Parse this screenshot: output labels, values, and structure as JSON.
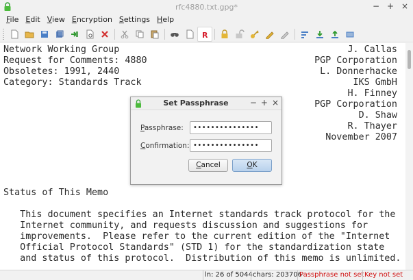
{
  "window": {
    "title": "rfc4880.txt.gpg*",
    "controls": [
      "−",
      "+",
      "×"
    ]
  },
  "menubar": [
    {
      "label": "File",
      "accel": "F",
      "rest": "ile"
    },
    {
      "label": "Edit",
      "accel": "E",
      "rest": "dit"
    },
    {
      "label": "View",
      "accel": "V",
      "rest": "iew"
    },
    {
      "label": "Encryption",
      "accel": "E",
      "rest": "ncryption"
    },
    {
      "label": "Settings",
      "accel": "S",
      "rest": "ettings"
    },
    {
      "label": "Help",
      "accel": "H",
      "rest": "elp"
    }
  ],
  "toolbar_icons": [
    "new-file-icon",
    "open-folder-icon",
    "save-icon",
    "save-as-icon",
    "reload-icon",
    "print-preview-icon",
    "close-icon",
    "cut-icon",
    "copy-icon",
    "paste-icon",
    "find-icon",
    "read-only-icon",
    "lock-icon",
    "unlock-icon",
    "key-icon",
    "key-edit-icon",
    "clear-icon",
    "sort-icon",
    "import-icon",
    "export-icon"
  ],
  "editor": {
    "header_left": [
      "Network Working Group",
      "Request for Comments: 4880",
      "Obsoletes: 1991, 2440",
      "Category: Standards Track"
    ],
    "header_right": [
      "J. Callas",
      "PGP Corporation",
      "L. Donnerhacke",
      "IKS GmbH",
      "H. Finney",
      "PGP Corporation",
      "D. Shaw",
      "R. Thayer",
      "November 2007"
    ],
    "section_title": "Status of This Memo",
    "body": [
      "   This document specifies an Internet standards track protocol for the",
      "   Internet community, and requests discussion and suggestions for",
      "   improvements.  Please refer to the current edition of the \"Internet",
      "   Official Protocol Standards\" (STD 1) for the standardization state",
      "   and status of this protocol.  Distribution of this memo is unlimited."
    ]
  },
  "statusbar": {
    "line": "ln: 26 of 5044",
    "chars": "chars: 203706",
    "passphrase": "Passphrase not set",
    "key": "Key not set",
    "warn_color": "#d01010"
  },
  "dialog": {
    "title": "Set Passphrase",
    "controls": [
      "−",
      "+",
      "×"
    ],
    "passphrase_label": "Passphrase:",
    "passphrase_value": "•••••••••••••••",
    "confirmation_label": "Confirmation:",
    "confirmation_value": "•••••••••••••••",
    "cancel_label": "Cancel",
    "ok_label": "OK"
  }
}
